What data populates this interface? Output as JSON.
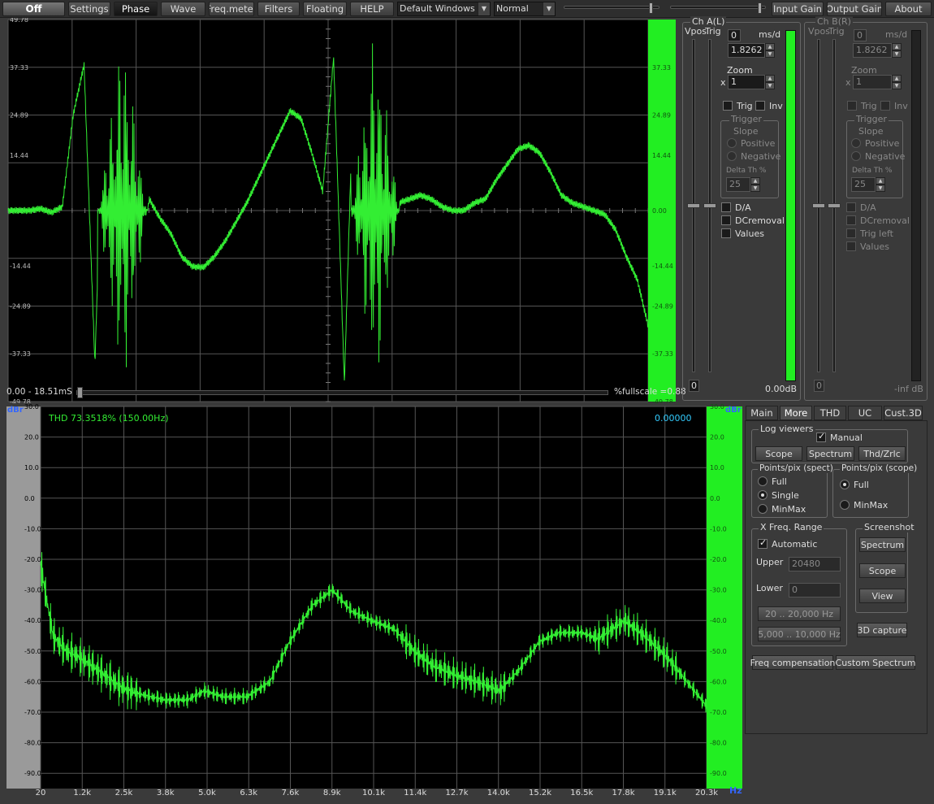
{
  "toolbar": {
    "off": "Off",
    "settings": "Settings",
    "phase": "Phase",
    "wave": "Wave",
    "freqmeter": "Freq.meter",
    "filters": "Filters",
    "floating": "Floating",
    "help": "HELP",
    "input_device": "Default Windows inp",
    "mode": "Normal",
    "input_gain": "Input Gain",
    "output_gain": "Output Gain",
    "about": "About",
    "input_slider_level": 0.93,
    "output_slider_level": 0.96
  },
  "scope": {
    "y_ticks_left": [
      "49.78",
      "37.33",
      "24.89",
      "14.44",
      "0.00",
      "-14.44",
      "-24.89",
      "-37.33",
      "-49.78"
    ],
    "y_ticks_right": [
      "37.33",
      "24.89",
      "14.44",
      "0.00",
      "-14.44",
      "-24.89",
      "-37.33",
      "-49.78"
    ],
    "time_range": "0.00 - 18.51mS",
    "fullscale": "%fullscale =0.88",
    "scroll_position": 0.0
  },
  "chA": {
    "title": "Ch A(L)",
    "vpos": "Vpos",
    "trig": "Trig",
    "ms_unit": "ms/d",
    "spin_val": "0",
    "ms_value": "1.8262",
    "zoom_label": "Zoom",
    "zoom_x": "x",
    "zoom_value": "1",
    "trig_cb": "Trig",
    "inv_cb": "Inv",
    "trigger_title": "Trigger",
    "slope": "Slope",
    "positive": "Positive",
    "negative": "Negative",
    "delta_th": "Delta Th %",
    "delta_value": "25",
    "da": "D/A",
    "dcremoval": "DCremoval",
    "values": "Values",
    "bottom_spin": "0",
    "level": "0.00dB",
    "meter_level": 1.0,
    "vpos_level": 0.5,
    "trig_level": 0.5
  },
  "chB": {
    "title": "Ch B(R)",
    "vpos": "Vpos",
    "trig": "Trig",
    "ms_unit": "ms/d",
    "spin_val": "0",
    "ms_value": "1.8262",
    "zoom_label": "Zoom",
    "zoom_x": "x",
    "zoom_value": "1",
    "trig_cb": "Trig",
    "inv_cb": "Inv",
    "trigger_title": "Trigger",
    "slope": "Slope",
    "positive": "Positive",
    "negative": "Negative",
    "delta_th": "Delta Th %",
    "delta_value": "25",
    "da": "D/A",
    "dcremoval": "DCremoval",
    "trig_left": "Trig left",
    "values": "Values",
    "bottom_spin": "0",
    "level": "-inf dB",
    "meter_level": 0.0,
    "vpos_level": 0.5,
    "trig_level": 0.5
  },
  "spectrum": {
    "dbr_left": "dBr",
    "dbr_right": "dBr",
    "hz": "Hz",
    "thd": "THD 73.3518% (150.00Hz)",
    "readout": "0.00000",
    "y_ticks": [
      "30.0",
      "20.0",
      "10.0",
      "0.0",
      "-10.0",
      "-20.0",
      "-30.0",
      "-40.0",
      "-50.0",
      "-60.0",
      "-70.0",
      "-80.0",
      "-90.0"
    ],
    "x_ticks": [
      "20",
      "1.2k",
      "2.5k",
      "3.8k",
      "5.0k",
      "6.3k",
      "7.6k",
      "8.9k",
      "10.1k",
      "11.4k",
      "12.7k",
      "14.0k",
      "15.2k",
      "16.5k",
      "17.8k",
      "19.1k",
      "20.3k"
    ]
  },
  "tabs": [
    "Main",
    "More",
    "THD",
    "UC",
    "Cust.3D"
  ],
  "more": {
    "log_viewers": "Log viewers",
    "manual": "Manual",
    "scope": "Scope",
    "spectrum": "Spectrum",
    "thd_zrlc": "Thd/Zrlc",
    "pts_spect": "Points/pix (spect)",
    "full": "Full",
    "single": "Single",
    "minmax": "MinMax",
    "pts_scope": "Points/pix (scope)",
    "full2": "Full",
    "minmax2": "MinMax",
    "xfreq": "X Freq. Range",
    "automatic": "Automatic",
    "upper": "Upper",
    "upper_val": "20480",
    "lower": "Lower",
    "lower_val": "0",
    "range1": "20 .. 20,000 Hz",
    "range2": "5,000 .. 10,000 Hz",
    "screenshot": "Screenshot",
    "ss_spectrum": "Spectrum",
    "ss_scope": "Scope",
    "ss_view": "View",
    "capture3d": "3D capture",
    "freq_comp": "Freq  compensation",
    "custom_spectrum": "Custom Spectrum"
  },
  "colors": {
    "trace": "#33ee33",
    "meter": "#22ee22",
    "grid": "#555555",
    "bg": "#000000",
    "axis_text": "#bbbbbb",
    "readout": "#33ccff"
  },
  "chart_data": [
    {
      "type": "line",
      "title": "",
      "xlabel": "",
      "ylabel": "",
      "xlim": [
        0,
        18.51
      ],
      "ylim": [
        -49.78,
        49.78
      ],
      "grid": true,
      "series": [
        {
          "values": [
            0,
            0,
            0,
            0.5,
            -0.5,
            1,
            25,
            38,
            -40,
            49,
            -45,
            30,
            -20,
            3,
            -2,
            -6,
            -12,
            -14.6,
            -14.8,
            -12,
            -8,
            -3,
            2,
            8,
            14,
            20,
            26,
            24,
            15,
            5,
            40,
            -45,
            49,
            -40,
            30,
            -10,
            2,
            3,
            4,
            3,
            1,
            0,
            0,
            2,
            3,
            8,
            12,
            16,
            17,
            15,
            10,
            4,
            2,
            1,
            0,
            -1,
            -5,
            -12,
            -18,
            -30
          ]
        }
      ]
    },
    {
      "type": "line",
      "title": "",
      "xlabel": "",
      "ylabel": "",
      "xlim": [
        20,
        20300
      ],
      "ylim": [
        -95,
        30
      ],
      "grid": true,
      "x": [
        20,
        400,
        800,
        1200,
        2000,
        2500,
        3000,
        3800,
        4500,
        5000,
        5600,
        6300,
        7000,
        7600,
        8300,
        8900,
        9500,
        10100,
        10800,
        11400,
        12000,
        12700,
        13300,
        14000,
        14600,
        15200,
        15800,
        16500,
        17000,
        17800,
        18400,
        19100,
        19700,
        20300
      ],
      "series": [
        {
          "values": [
            -22,
            -45,
            -50,
            -52,
            -58,
            -62,
            -64,
            -66,
            -66,
            -63,
            -65,
            -65,
            -60,
            -47,
            -35,
            -30,
            -37,
            -40,
            -43,
            -50,
            -55,
            -58,
            -60,
            -63,
            -56,
            -47,
            -44,
            -44,
            -46,
            -40,
            -45,
            -52,
            -60,
            -68
          ]
        }
      ]
    }
  ]
}
